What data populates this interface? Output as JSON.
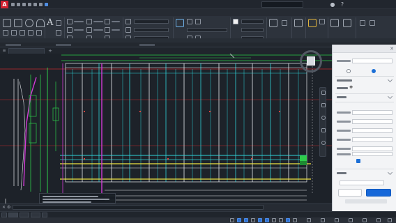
{
  "app": {
    "title": "",
    "window_controls": [
      "",
      "",
      ""
    ]
  },
  "menubar": {
    "items": [
      "",
      "",
      "",
      "",
      "",
      "",
      "",
      "",
      "",
      "",
      "",
      "",
      "",
      ""
    ]
  },
  "ribbon": {
    "tabs": [
      "",
      "",
      "",
      "",
      "",
      "",
      "",
      ""
    ]
  },
  "drawing_tab": {
    "label": "",
    "add_label": "+"
  },
  "colors": {
    "accent": "#1768d9",
    "canvas_bg": "#1d2229",
    "grid_cyan": "#2fd4d9",
    "grid_white": "#e8ecf0",
    "line_yellow": "#f0e442",
    "line_magenta": "#d23ad6",
    "line_green": "#2ecc4a",
    "line_red": "#c0282d",
    "app_brand": "#d1202f"
  },
  "navigation": {
    "cube_icon": "view-cube-icon",
    "tools": [
      "pan-icon",
      "zoom-icon",
      "orbit-icon",
      "showmotion-icon",
      "steering-wheel-icon"
    ]
  },
  "panel": {
    "title": "",
    "close_label": "✕",
    "fields": [
      "",
      "",
      "",
      "",
      "",
      "",
      "",
      ""
    ],
    "ok_label": "",
    "cancel_label": ""
  },
  "command_line": {
    "placeholder": ""
  },
  "layouts": {
    "tabs": [
      "",
      "",
      ""
    ]
  },
  "status": {
    "icons": [
      "grid-icon",
      "snap-icon",
      "ortho-icon",
      "polar-icon",
      "osnap-icon",
      "otrack-icon",
      "lineweight-icon",
      "transparency-icon",
      "selection-icon",
      "annotation-icon",
      "workspace-icon",
      "settings-icon"
    ]
  }
}
